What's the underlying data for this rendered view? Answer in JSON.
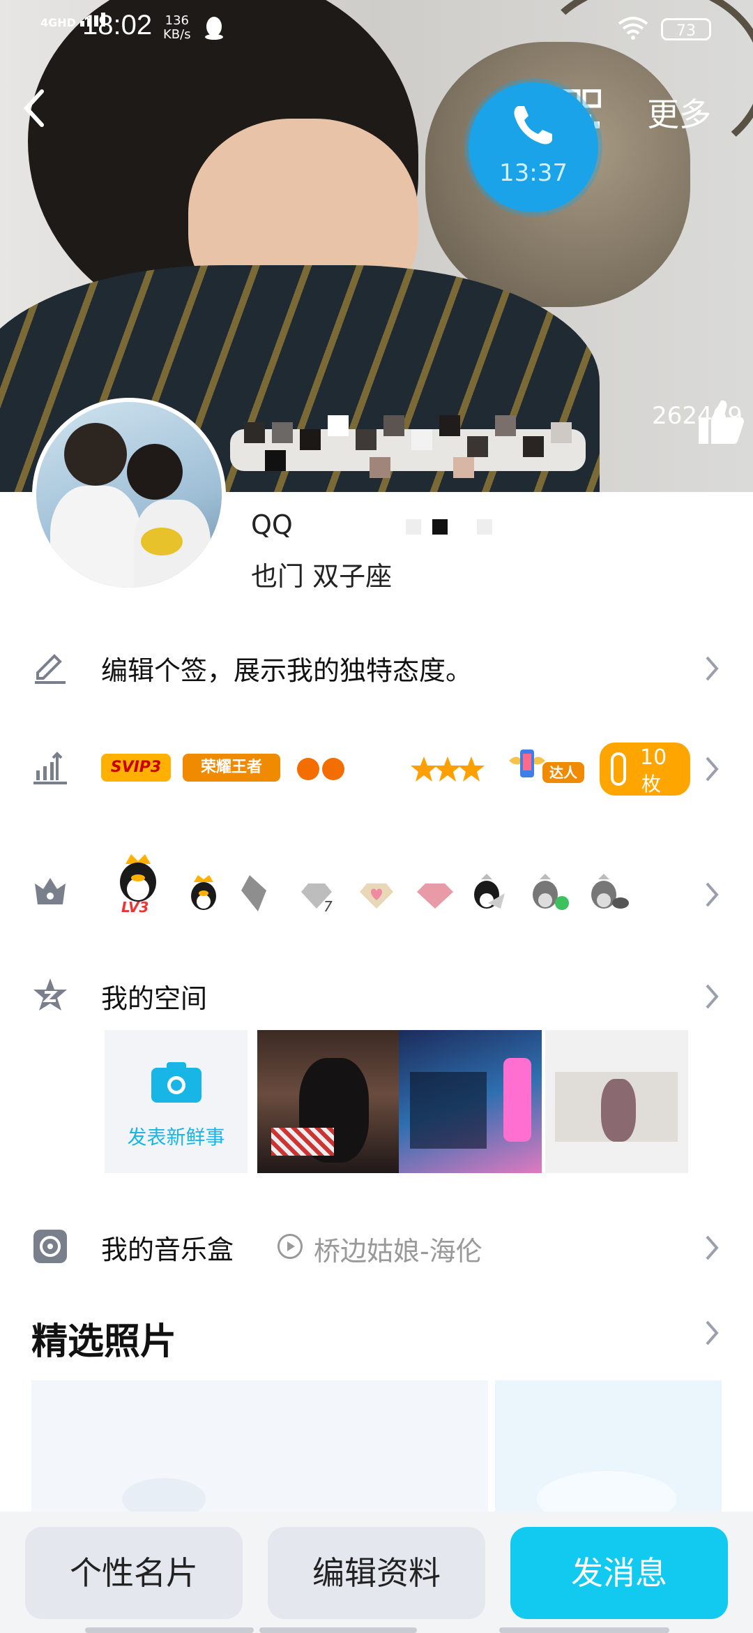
{
  "status_bar": {
    "network": "4GHD",
    "time": "18:02",
    "speed_value": "136",
    "speed_unit": "KB/s",
    "battery": "73"
  },
  "header": {
    "more_label": "更多",
    "call_timer": "13:37",
    "like_count": "262469"
  },
  "profile": {
    "line1": "QQ",
    "line2": "也门  双子座"
  },
  "signature": {
    "text": "编辑个签，展示我的独特态度。"
  },
  "badges": {
    "svip": "SVIP3",
    "honor": "荣耀王者",
    "daren": "达人",
    "coupon_num": "10",
    "coupon_unit": "枚"
  },
  "qq_level": {
    "lv": "LV3",
    "diamond_num": "7"
  },
  "space": {
    "title": "我的空间",
    "post_label": "发表新鲜事"
  },
  "music": {
    "title": "我的音乐盒",
    "song": "桥边姑娘-海伦"
  },
  "featured": {
    "title": "精选照片"
  },
  "bottom_buttons": {
    "card": "个性名片",
    "edit": "编辑资料",
    "message": "发消息"
  },
  "colors": {
    "accent": "#12c9f0",
    "call_blue": "#1aa3e8",
    "icon_gray": "#7a7f8c"
  }
}
